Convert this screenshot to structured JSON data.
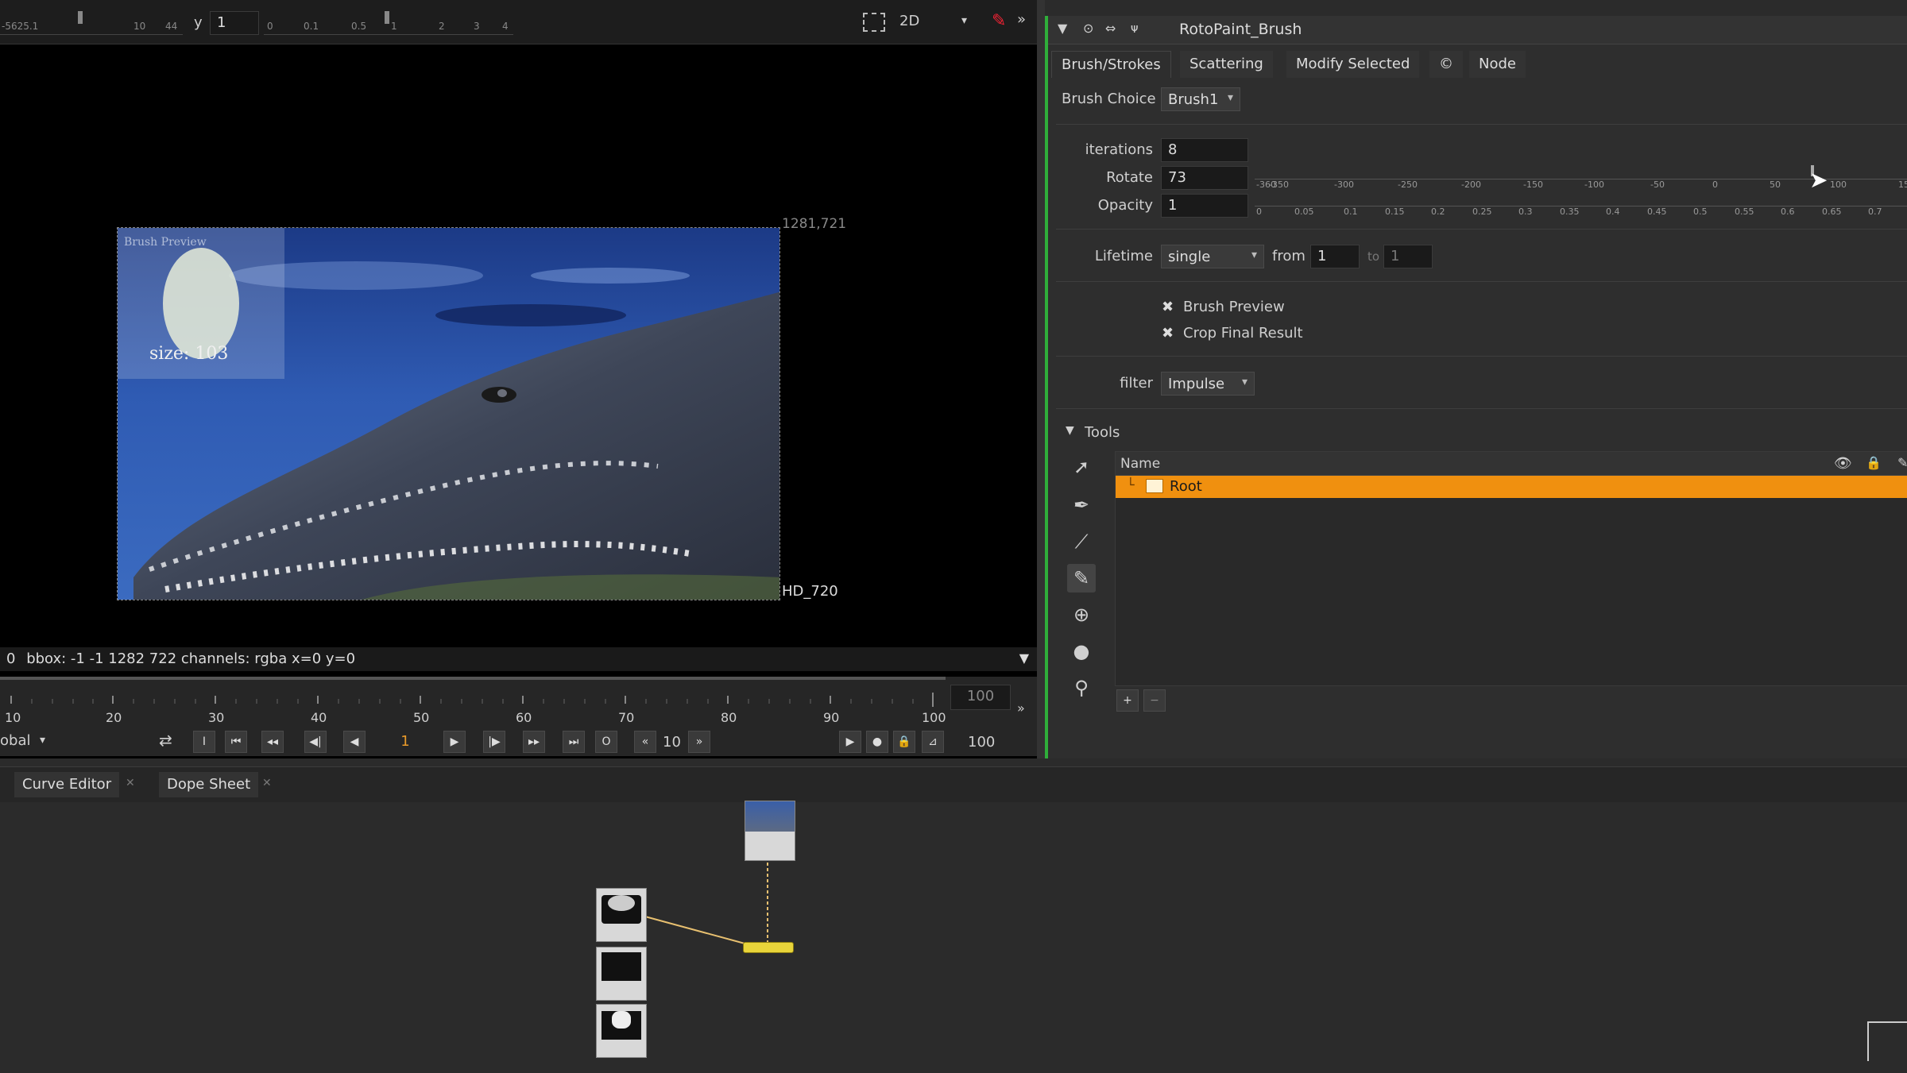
{
  "viewer": {
    "y_label": "y",
    "y_value": "1",
    "view_mode": "2D",
    "top_ruler_ticks": [
      "-5625.1",
      "10",
      "44",
      "0",
      "0.1",
      "0.5",
      "1",
      "2",
      "3",
      "4"
    ],
    "preview_label": "Brush Preview",
    "size_label": "size: 103",
    "corner_coords": "1281,721",
    "format_label": "HD_720",
    "info_text": "bbox: -1 -1 1282 722 channels: rgba  x=0 y=0",
    "info_prefix": "0"
  },
  "timeline": {
    "ticks": [
      "10",
      "20",
      "30",
      "40",
      "50",
      "60",
      "70",
      "80",
      "90",
      "100"
    ],
    "end_frame_box": "100",
    "global_label": "obal",
    "current_frame": "1",
    "step": "10",
    "end_frame": "100",
    "o_label": "O",
    "i_label": "I"
  },
  "props": {
    "node_name": "RotoPaint_Brush",
    "tabs": [
      "Brush/Strokes",
      "Scattering",
      "Modify Selected",
      "©",
      "Node"
    ],
    "brush_choice_label": "Brush Choice",
    "brush_choice_value": "Brush1",
    "iterations_label": "iterations",
    "iterations_value": "8",
    "rotate_label": "Rotate",
    "rotate_value": "73",
    "opacity_label": "Opacity",
    "opacity_value": "1",
    "rotate_scale": [
      "-360",
      "-350",
      "-300",
      "-250",
      "-200",
      "-150",
      "-100",
      "-50",
      "0",
      "50",
      "100",
      "15"
    ],
    "opacity_scale": [
      "0",
      "0.05",
      "0.1",
      "0.15",
      "0.2",
      "0.25",
      "0.3",
      "0.35",
      "0.4",
      "0.45",
      "0.5",
      "0.55",
      "0.6",
      "0.65",
      "0.7"
    ],
    "lifetime_label": "Lifetime",
    "lifetime_value": "single",
    "from_label": "from",
    "from_value": "1",
    "to_label": "to",
    "to_value": "1",
    "brush_preview_label": "Brush Preview",
    "crop_final_label": "Crop Final Result",
    "filter_label": "filter",
    "filter_value": "Impulse",
    "tools_label": "Tools",
    "tree_header_name": "Name",
    "tree_root": "Root",
    "add_label": "+",
    "remove_label": "−"
  },
  "nodegraph": {
    "tabs": [
      "Curve Editor",
      "Dope Sheet"
    ]
  },
  "colors": {
    "accent_green": "#2fae3a",
    "selection_orange": "#f0900f",
    "node_yellow": "#e8d43a"
  }
}
